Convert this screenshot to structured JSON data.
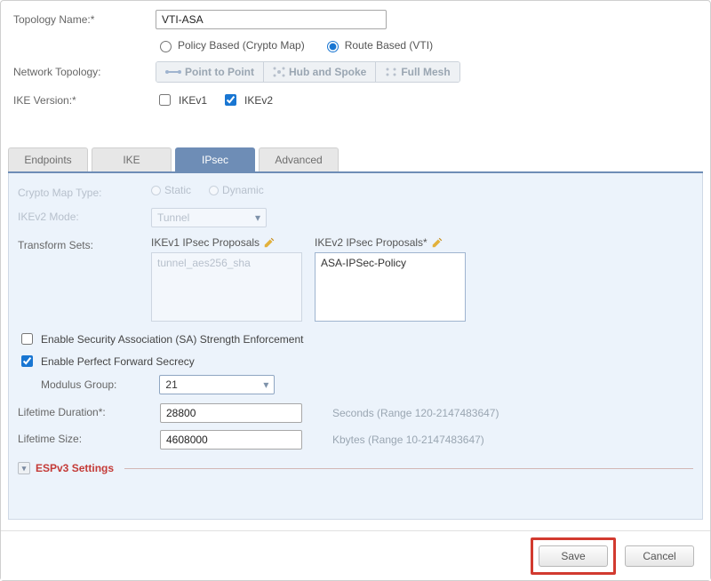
{
  "top": {
    "topologyNameLabel": "Topology Name:*",
    "topologyNameValue": "VTI-ASA",
    "policyBasedLabel": "Policy Based (Crypto Map)",
    "routeBasedLabel": "Route Based (VTI)",
    "networkTopologyLabel": "Network Topology:",
    "p2p": "Point to Point",
    "hub": "Hub and Spoke",
    "mesh": "Full Mesh",
    "ikeVersionLabel": "IKE Version:*",
    "ikev1Label": "IKEv1",
    "ikev2Label": "IKEv2"
  },
  "tabs": {
    "endpoints": "Endpoints",
    "ike": "IKE",
    "ipsec": "IPsec",
    "advanced": "Advanced"
  },
  "ipsec": {
    "cryptoMapTypeLabel": "Crypto Map Type:",
    "static": "Static",
    "dynamic": "Dynamic",
    "ikev2ModeLabel": "IKEv2 Mode:",
    "ikev2ModeValue": "Tunnel",
    "transformSetsLabel": "Transform Sets:",
    "ikev1ProposalsLabel": "IKEv1 IPsec Proposals",
    "ikev1ProposalsValue": "tunnel_aes256_sha",
    "ikev2ProposalsLabel": "IKEv2 IPsec Proposals*",
    "ikev2ProposalsValue": "ASA-IPSec-Policy",
    "saEnforcementLabel": "Enable Security Association (SA) Strength Enforcement",
    "pfsLabel": "Enable Perfect Forward Secrecy",
    "modulusGroupLabel": "Modulus Group:",
    "modulusGroupValue": "21",
    "lifetimeDurationLabel": "Lifetime Duration*:",
    "lifetimeDurationValue": "28800",
    "lifetimeDurationHint": "Seconds (Range 120-2147483647)",
    "lifetimeSizeLabel": "Lifetime Size:",
    "lifetimeSizeValue": "4608000",
    "lifetimeSizeHint": "Kbytes (Range 10-2147483647)",
    "espv3Label": "ESPv3 Settings"
  },
  "footer": {
    "save": "Save",
    "cancel": "Cancel"
  }
}
